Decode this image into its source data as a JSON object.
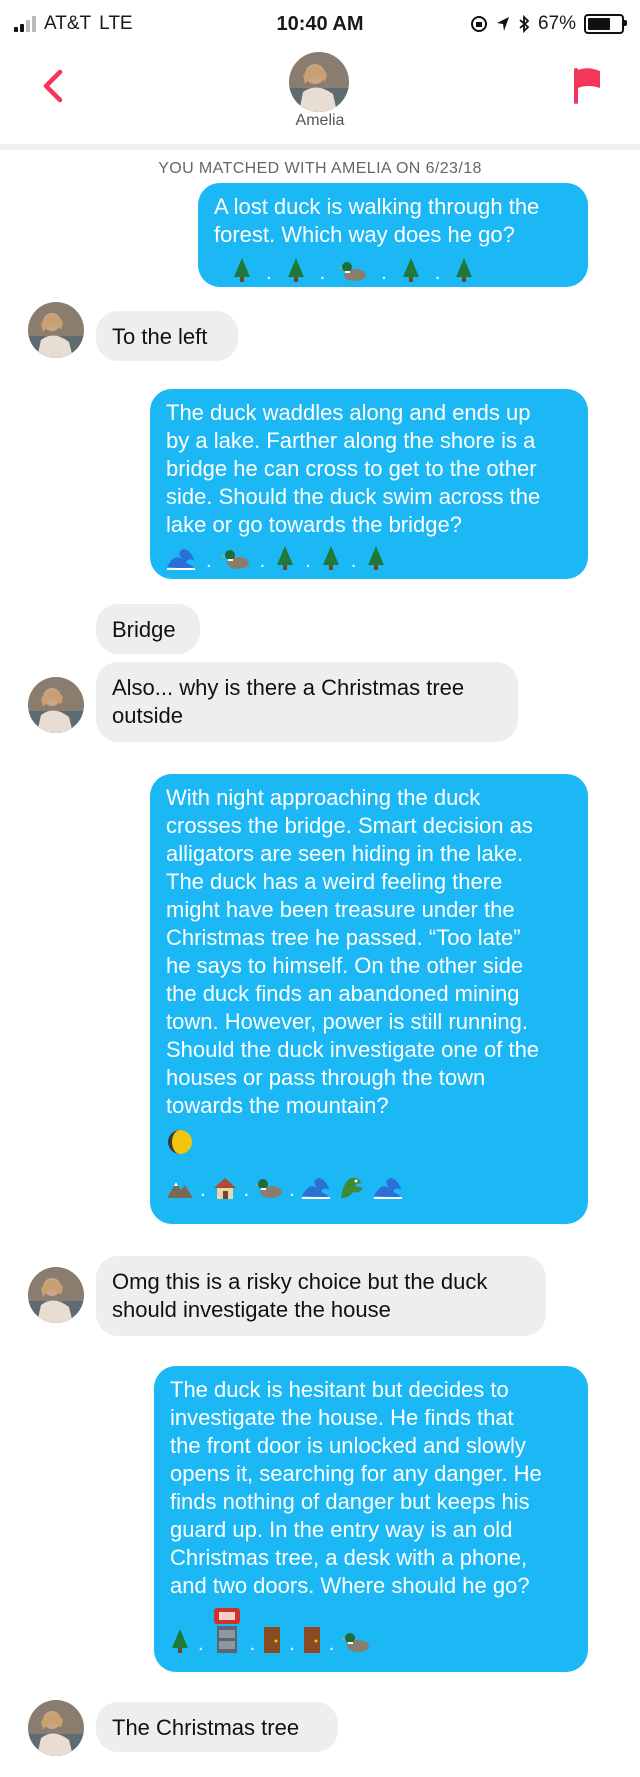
{
  "status": {
    "carrier": "AT&T",
    "network": "LTE",
    "time": "10:40 AM",
    "battery": "67%"
  },
  "header": {
    "name": "Amelia"
  },
  "match_note": "YOU MATCHED WITH AMELIA ON 6/23/18",
  "messages": [
    {
      "from": "me",
      "lines": [
        "A lost duck is walking through the",
        "forest. Which way does he go?"
      ]
    },
    {
      "from": "amelia",
      "lines": [
        "To the left"
      ]
    },
    {
      "from": "me",
      "lines": [
        "The duck waddles along and ends up",
        "by a lake. Farther along the shore is a",
        "bridge he can cross to get to the other",
        "side. Should the duck swim across the",
        "lake or go towards the bridge?"
      ]
    },
    {
      "from": "amelia",
      "lines": [
        "Bridge"
      ]
    },
    {
      "from": "amelia",
      "lines": [
        "Also... why is there a Christmas tree",
        "outside"
      ]
    },
    {
      "from": "me",
      "lines": [
        "With night approaching the duck",
        "crosses the bridge. Smart decision as",
        "alligators are seen hiding in the lake.",
        "The duck has a weird feeling there",
        "might have been treasure under the",
        "Christmas tree he passed. “Too late”",
        "he says to himself. On the other side",
        "the duck finds an abandoned mining",
        "town. However, power is still running.",
        "Should the duck investigate one of the",
        "houses or pass through the town",
        "towards the mountain?"
      ]
    },
    {
      "from": "amelia",
      "lines": [
        "Omg this is a risky choice but the duck",
        "should investigate the house"
      ]
    },
    {
      "from": "me",
      "lines": [
        "The duck is hesitant but decides to",
        "investigate the house. He finds that",
        "the front door is unlocked and slowly",
        "opens it, searching for any danger. He",
        "finds nothing of danger but keeps his",
        "guard up. In the entry way is an old",
        "Christmas tree, a desk with a phone,",
        "and two doors. Where should he go?"
      ]
    },
    {
      "from": "amelia",
      "lines": [
        "The Christmas tree"
      ]
    }
  ],
  "icons": {
    "msg1": [
      "tree",
      "tree",
      "duck",
      "tree",
      "tree"
    ],
    "msg3": [
      "wave",
      "duck",
      "tree",
      "tree",
      "tree"
    ],
    "msg6_moon": "moon",
    "msg6": [
      "mountain",
      "house",
      "duck",
      "wave",
      "crocodile",
      "wave"
    ],
    "msg8": [
      "tree",
      "phone-desk",
      "door",
      "door",
      "duck"
    ]
  },
  "colors": {
    "sent_bubble": "#1bb8f5",
    "received_bubble": "#eeeeee",
    "accent": "#f4365b"
  }
}
